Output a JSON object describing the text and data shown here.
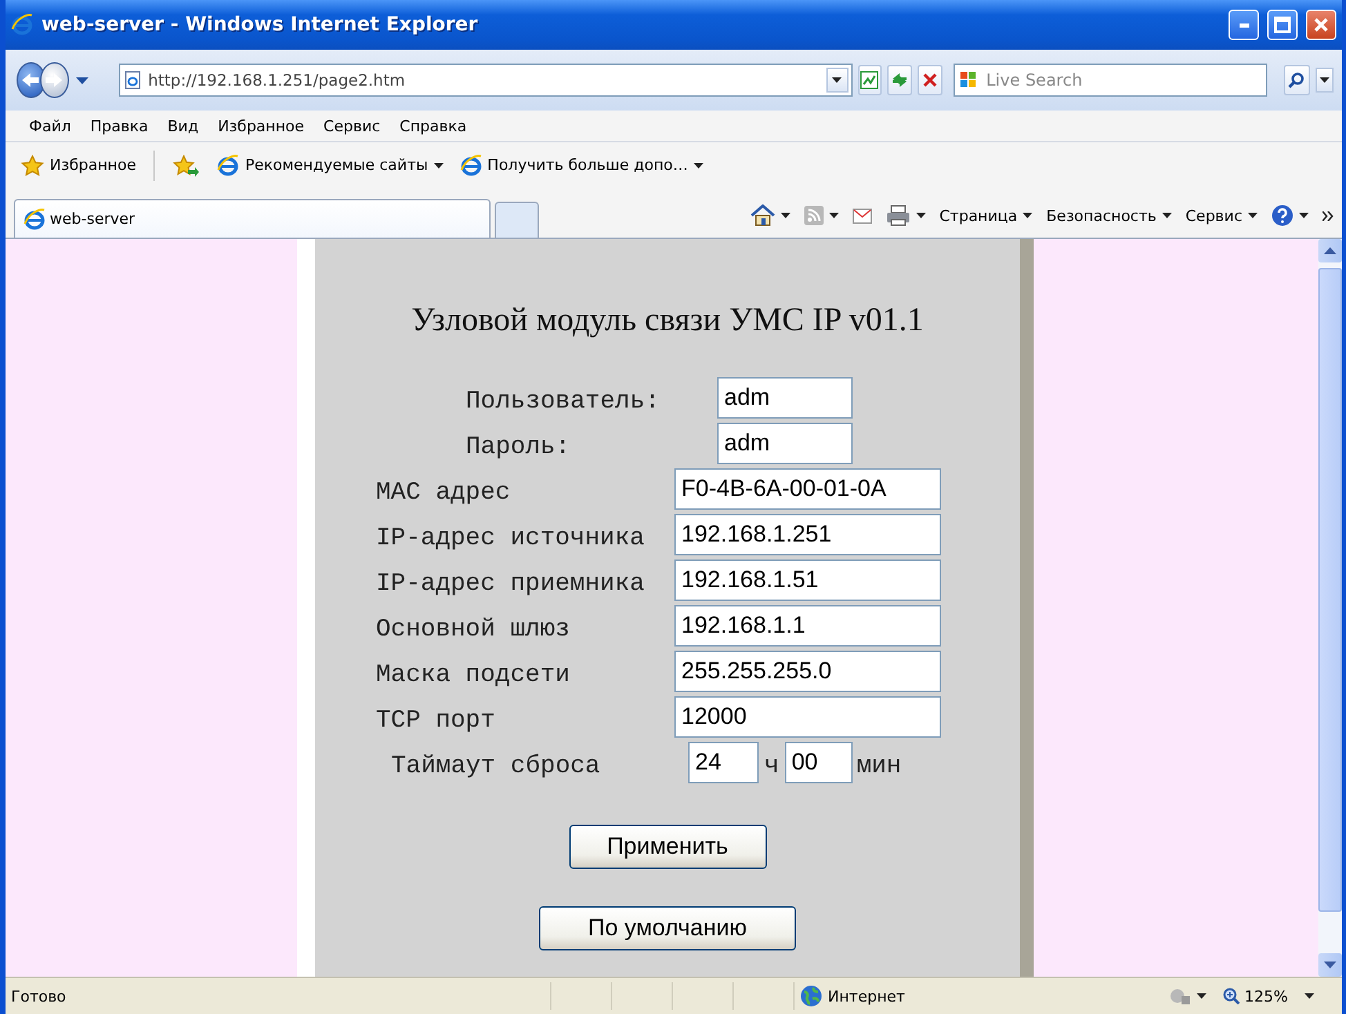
{
  "window": {
    "title": "web-server - Windows Internet Explorer"
  },
  "address_bar": {
    "url": "http://192.168.1.251/page2.htm",
    "search_placeholder": "Live Search"
  },
  "menu": [
    "Файл",
    "Правка",
    "Вид",
    "Избранное",
    "Сервис",
    "Справка"
  ],
  "favorites_bar": {
    "favorites": "Избранное",
    "links": [
      "Рекомендуемые сайты",
      "Получить больше допо…"
    ]
  },
  "tabs": [
    {
      "label": "web-server",
      "selected": true
    }
  ],
  "command_bar": [
    "Страница",
    "Безопасность",
    "Сервис"
  ],
  "page": {
    "heading": "Узловой модуль связи УМС IP v01.1",
    "login": [
      {
        "label": "Пользователь:",
        "value": "adm"
      },
      {
        "label": "Пароль:",
        "value": "adm"
      }
    ],
    "fields": [
      {
        "label": "MAC адрес",
        "value": "F0-4B-6A-00-01-0A"
      },
      {
        "label": "IP-адрес источника",
        "value": "192.168.1.251"
      },
      {
        "label": "IP-адрес приемника",
        "value": "192.168.1.51"
      },
      {
        "label": "Основной шлюз",
        "value": "192.168.1.1"
      },
      {
        "label": "Маска подсети",
        "value": "255.255.255.0"
      },
      {
        "label": "TCP порт",
        "value": "12000"
      }
    ],
    "timeout": {
      "label": "Таймаут сброса",
      "hours": "24",
      "hours_unit": "ч",
      "minutes": "00",
      "minutes_unit": "мин"
    },
    "buttons": [
      "Применить",
      "По умолчанию"
    ]
  },
  "status_bar": {
    "status": "Готово",
    "zone": "Интернет",
    "zoom": "125%"
  }
}
